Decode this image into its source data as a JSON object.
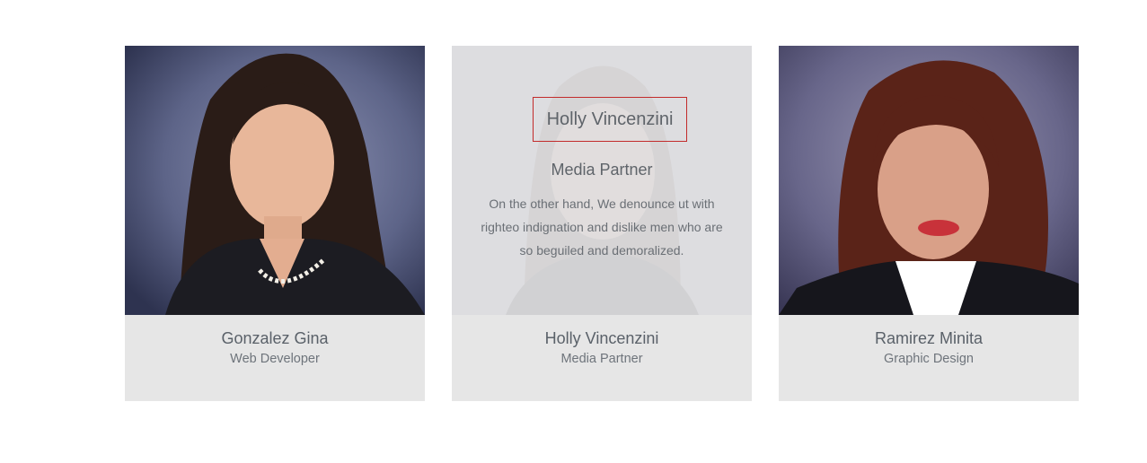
{
  "members": [
    {
      "name": "Gonzalez Gina",
      "role": "Web Developer"
    },
    {
      "name": "Holly Vincenzini",
      "role": "Media Partner"
    },
    {
      "name": "Ramirez Minita",
      "role": "Graphic Design"
    }
  ],
  "hover_overlay": {
    "name": "Holly Vincenzini",
    "role": "Media Partner",
    "description": "On the other hand, We denounce ut with righteo indignation and dislike men who are so beguiled and demoralized."
  },
  "colors": {
    "card_background": "#e6e6e6",
    "name_text": "#5a6169",
    "role_text": "#6e747b",
    "focus_border": "#c22b2b"
  }
}
